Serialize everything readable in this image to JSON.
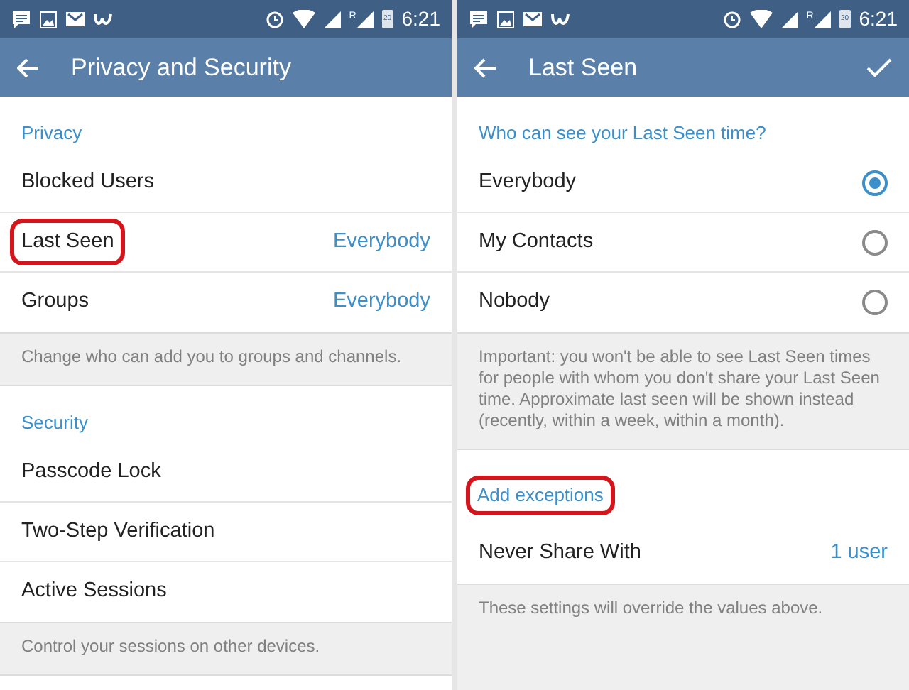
{
  "screens": [
    {
      "status_bar": {
        "time": "6:21",
        "signal_badge": "R",
        "battery": "20"
      },
      "app_bar": {
        "title": "Privacy and Security",
        "confirm": false
      },
      "sections": [
        {
          "kind": "list",
          "header": "Privacy",
          "rows": [
            {
              "kind": "item",
              "label": "Blocked Users",
              "highlighted": false
            },
            {
              "kind": "item",
              "label": "Last Seen",
              "value": "Everybody",
              "highlighted": true
            },
            {
              "kind": "item",
              "label": "Groups",
              "value": "Everybody",
              "highlighted": false
            }
          ]
        },
        {
          "kind": "info",
          "text": "Change who can add you to groups and channels."
        },
        {
          "kind": "list",
          "header": "Security",
          "rows": [
            {
              "kind": "item",
              "label": "Passcode Lock",
              "highlighted": false
            },
            {
              "kind": "item",
              "label": "Two-Step Verification",
              "highlighted": false
            },
            {
              "kind": "item",
              "label": "Active Sessions",
              "highlighted": false
            }
          ]
        },
        {
          "kind": "info",
          "text": "Control your sessions on other devices."
        },
        {
          "kind": "blank"
        }
      ]
    },
    {
      "status_bar": {
        "time": "6:21",
        "signal_badge": "R",
        "battery": "20"
      },
      "app_bar": {
        "title": "Last Seen",
        "confirm": true
      },
      "sections": [
        {
          "kind": "list",
          "header": "Who can see your Last Seen time?",
          "header_highlighted": false,
          "rows": [
            {
              "kind": "radio",
              "label": "Everybody",
              "selected": true
            },
            {
              "kind": "radio",
              "label": "My Contacts",
              "selected": false
            },
            {
              "kind": "radio",
              "label": "Nobody",
              "selected": false
            }
          ]
        },
        {
          "kind": "info",
          "text": "Important: you won't be able to see Last Seen times for people with whom you don't share your Last Seen time. Approximate last seen will be shown instead (recently, within a week, within a month)."
        },
        {
          "kind": "list",
          "header": "Add exceptions",
          "header_highlighted": true,
          "rows": [
            {
              "kind": "item",
              "label": "Never Share With",
              "value": "1 user",
              "highlighted": false
            }
          ]
        },
        {
          "kind": "info",
          "text": "These settings will override the values above."
        }
      ]
    }
  ]
}
